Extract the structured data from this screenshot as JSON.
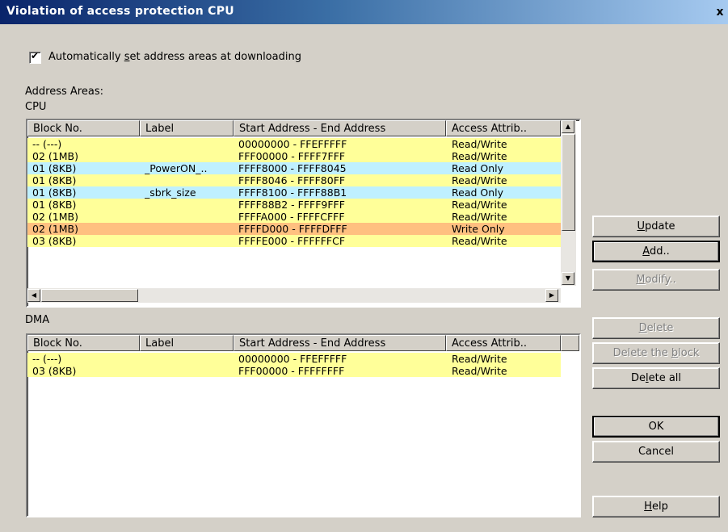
{
  "window": {
    "title": "Violation of access protection  CPU",
    "close": "x"
  },
  "auto_checkbox": {
    "checked": true,
    "label_pre": "Automatically ",
    "label_mn": "s",
    "label_post": "et address areas at downloading"
  },
  "labels": {
    "address_areas": "Address Areas:",
    "cpu": "CPU",
    "dma": "DMA"
  },
  "columns": [
    "Block No.",
    "Label",
    "Start Address - End Address",
    "Access Attrib.."
  ],
  "cpu_rows": [
    {
      "block": "-- (---)",
      "label": "",
      "range": "00000000 - FFEFFFFF",
      "attr": "Read/Write",
      "color": "#ffff99"
    },
    {
      "block": "02 (1MB)",
      "label": "",
      "range": "FFF00000 - FFFF7FFF",
      "attr": "Read/Write",
      "color": "#ffff99"
    },
    {
      "block": "01 (8KB)",
      "label": "_PowerON_..",
      "range": "FFFF8000 - FFFF8045",
      "attr": "Read Only",
      "color": "#bff0ff"
    },
    {
      "block": "01 (8KB)",
      "label": "",
      "range": "FFFF8046 - FFFF80FF",
      "attr": "Read/Write",
      "color": "#ffff99"
    },
    {
      "block": "01 (8KB)",
      "label": "_sbrk_size",
      "range": "FFFF8100 - FFFF88B1",
      "attr": "Read Only",
      "color": "#bff0ff"
    },
    {
      "block": "01 (8KB)",
      "label": "",
      "range": "FFFF88B2 - FFFF9FFF",
      "attr": "Read/Write",
      "color": "#ffff99"
    },
    {
      "block": "02 (1MB)",
      "label": "",
      "range": "FFFFA000 - FFFFCFFF",
      "attr": "Read/Write",
      "color": "#ffff99"
    },
    {
      "block": "02 (1MB)",
      "label": "",
      "range": "FFFFD000 - FFFFDFFF",
      "attr": "Write Only",
      "color": "#ffc080"
    },
    {
      "block": "03 (8KB)",
      "label": "",
      "range": "FFFFE000 - FFFFFFCF",
      "attr": "Read/Write",
      "color": "#ffff99"
    }
  ],
  "dma_rows": [
    {
      "block": "-- (---)",
      "label": "",
      "range": "00000000 - FFEFFFFF",
      "attr": "Read/Write",
      "color": "#ffff99"
    },
    {
      "block": "03 (8KB)",
      "label": "",
      "range": "FFF00000 - FFFFFFFF",
      "attr": "Read/Write",
      "color": "#ffff99"
    }
  ],
  "buttons": {
    "update": {
      "pre": "",
      "mn": "U",
      "post": "pdate"
    },
    "add": {
      "pre": "",
      "mn": "A",
      "post": "dd.."
    },
    "modify": {
      "pre": "",
      "mn": "M",
      "post": "odify.."
    },
    "delete": {
      "pre": "",
      "mn": "D",
      "post": "elete"
    },
    "delete_block": {
      "pre": "Delete the ",
      "mn": "b",
      "post": "lock"
    },
    "delete_all": {
      "pre": "De",
      "mn": "l",
      "post": "ete all"
    },
    "ok": {
      "pre": "OK",
      "mn": "",
      "post": ""
    },
    "cancel": {
      "pre": "Cancel",
      "mn": "",
      "post": ""
    },
    "help": {
      "pre": "",
      "mn": "H",
      "post": "elp"
    }
  }
}
